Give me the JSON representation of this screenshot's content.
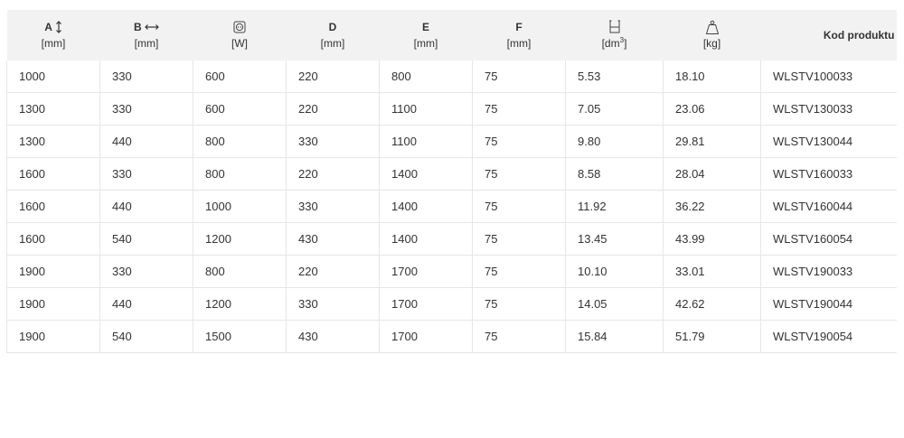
{
  "columns": [
    {
      "top": "A",
      "icon": "vertical-arrow-icon",
      "unit": "[mm]"
    },
    {
      "top": "B",
      "icon": "horizontal-arrow-icon",
      "unit": "[mm]"
    },
    {
      "top": "",
      "icon": "power-outlet-icon",
      "unit": "[W]"
    },
    {
      "top": "D",
      "icon": "",
      "unit": "[mm]"
    },
    {
      "top": "E",
      "icon": "",
      "unit": "[mm]"
    },
    {
      "top": "F",
      "icon": "",
      "unit": "[mm]"
    },
    {
      "top": "",
      "icon": "volume-container-icon",
      "unit_main": "[dm",
      "unit_sup": "3",
      "unit_end": "]"
    },
    {
      "top": "",
      "icon": "weight-icon",
      "unit": "[kg]"
    },
    {
      "top": "Kod produktu",
      "icon": "",
      "unit": ""
    }
  ],
  "rows": [
    [
      "1000",
      "330",
      "600",
      "220",
      "800",
      "75",
      "5.53",
      "18.10",
      "WLSTV100033"
    ],
    [
      "1300",
      "330",
      "600",
      "220",
      "1100",
      "75",
      "7.05",
      "23.06",
      "WLSTV130033"
    ],
    [
      "1300",
      "440",
      "800",
      "330",
      "1100",
      "75",
      "9.80",
      "29.81",
      "WLSTV130044"
    ],
    [
      "1600",
      "330",
      "800",
      "220",
      "1400",
      "75",
      "8.58",
      "28.04",
      "WLSTV160033"
    ],
    [
      "1600",
      "440",
      "1000",
      "330",
      "1400",
      "75",
      "11.92",
      "36.22",
      "WLSTV160044"
    ],
    [
      "1600",
      "540",
      "1200",
      "430",
      "1400",
      "75",
      "13.45",
      "43.99",
      "WLSTV160054"
    ],
    [
      "1900",
      "330",
      "800",
      "220",
      "1700",
      "75",
      "10.10",
      "33.01",
      "WLSTV190033"
    ],
    [
      "1900",
      "440",
      "1200",
      "330",
      "1700",
      "75",
      "14.05",
      "42.62",
      "WLSTV190044"
    ],
    [
      "1900",
      "540",
      "1500",
      "430",
      "1700",
      "75",
      "15.84",
      "51.79",
      "WLSTV190054"
    ]
  ]
}
